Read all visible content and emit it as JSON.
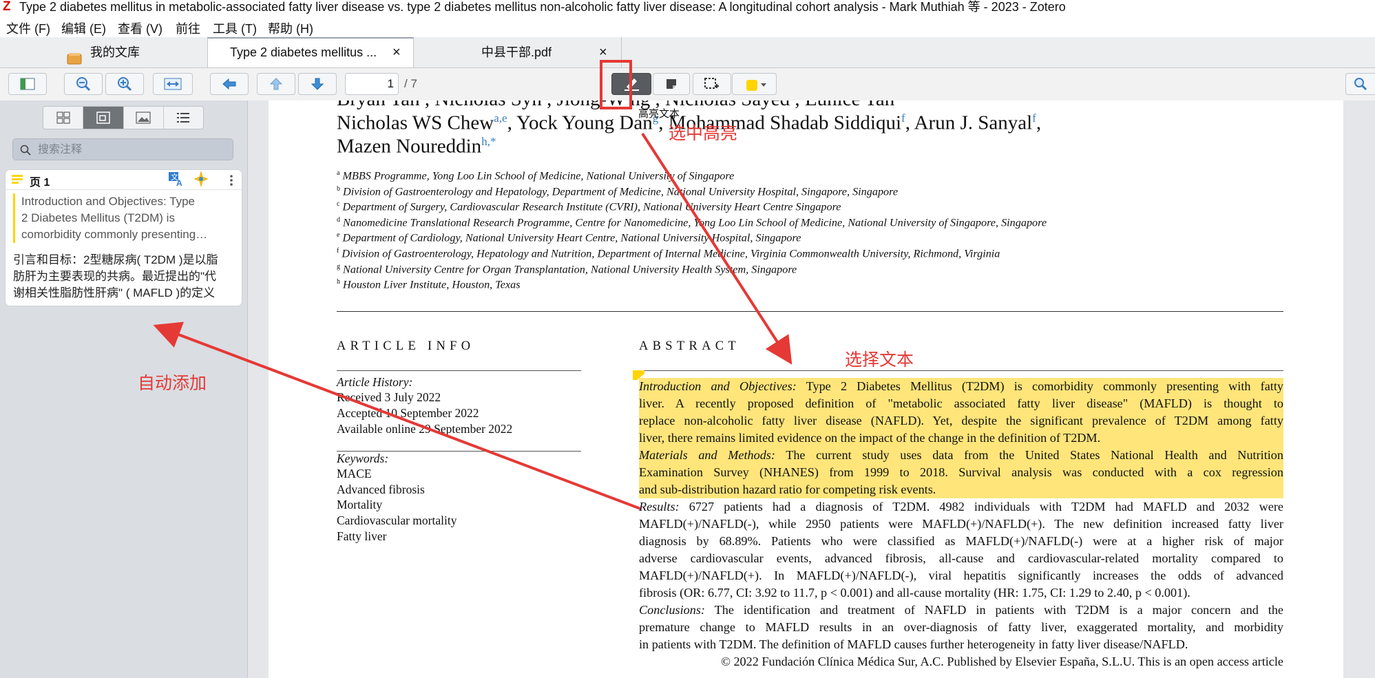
{
  "window": {
    "title": "Type 2 diabetes mellitus in metabolic-associated fatty liver disease vs. type 2 diabetes mellitus non-alcoholic fatty liver disease: A longitudinal cohort analysis - Mark Muthiah 等 - 2023 - Zotero"
  },
  "menu": [
    "文件 (F)",
    "编辑 (E)",
    "查看 (V)",
    "前往",
    "工具 (T)",
    "帮助 (H)"
  ],
  "tabs": [
    {
      "label": "我的文库",
      "icon": "library-icon"
    },
    {
      "label": "Type 2 diabetes mellitus ...",
      "close": "×"
    },
    {
      "label": "中县干部.pdf",
      "close": "×"
    }
  ],
  "toolbar": {
    "page_current": "1",
    "page_total": "/ 7",
    "highlight_tooltip": "高亮文本",
    "highlight_color": "#ffd400"
  },
  "sidebar": {
    "search_placeholder": "搜索注释",
    "annotation": {
      "page_label": "页 1",
      "quote_lines": [
        "Introduction and Objectives: Type",
        "2 Diabetes Mellitus (T2DM) is",
        "comorbidity commonly presenting…"
      ],
      "comment_lines": [
        "引言和目标：2型糖尿病( T2DM )是以脂",
        "肪肝为主要表现的共病。最近提出的\"代",
        "谢相关性脂肪性肝病\" ( MAFLD )的定义"
      ]
    }
  },
  "document": {
    "author_line1": "Bryan Tan , Nicholas Syn , Jiong-W  ng , Nicholas Sayed , Eunice Tan",
    "author_line2_parts": [
      "Nicholas WS Chew",
      "a,e",
      ", Yock Young Dan",
      "g",
      ", Mohammad Shadab Siddiqui",
      "f",
      ", Arun J. Sanyal",
      "f",
      ","
    ],
    "author_line3_parts": [
      "Mazen Noureddin",
      "h,*"
    ],
    "affiliations": [
      {
        "sup": "a",
        "text": "MBBS Programme, Yong Loo Lin School of Medicine, National University of Singapore"
      },
      {
        "sup": "b",
        "text": "Division of Gastroenterology and Hepatology, Department of Medicine, National University Hospital, Singapore, Singapore"
      },
      {
        "sup": "c",
        "text": "Department of Surgery, Cardiovascular Research Institute (CVRI), National University Heart Centre Singapore"
      },
      {
        "sup": "d",
        "text": "Nanomedicine Translational Research Programme, Centre for Nanomedicine, Yong Loo Lin School of Medicine, National University of Singapore, Singapore"
      },
      {
        "sup": "e",
        "text": "Department of Cardiology, National University Heart Centre, National University Hospital, Singapore"
      },
      {
        "sup": "f",
        "text": "Division of Gastroenterology, Hepatology and Nutrition, Department of Internal Medicine, Virginia Commonwealth University, Richmond, Virginia"
      },
      {
        "sup": "g",
        "text": "National University Centre for Organ Transplantation, National University Health System, Singapore"
      },
      {
        "sup": "h",
        "text": "Houston Liver Institute, Houston, Texas"
      }
    ],
    "article_info_heading": "ARTICLE INFO",
    "history_label": "Article History:",
    "history": [
      "Received 3 July 2022",
      "Accepted 10 September 2022",
      "Available online 29 September 2022"
    ],
    "keywords_label": "Keywords:",
    "keywords": [
      "MACE",
      "Advanced fibrosis",
      "Mortality",
      "Cardiovascular mortality",
      "Fatty liver"
    ],
    "abstract_heading": "ABSTRACT",
    "abstract_lines": [
      {
        "lead": "Introduction and Objectives:",
        "text": " Type 2 Diabetes Mellitus (T2DM) is comorbidity commonly presenting with fatty",
        "hl": true
      },
      {
        "lead": "",
        "text": "liver. A recently proposed definition of \"metabolic associated fatty liver disease\" (MAFLD) is thought to",
        "hl": true
      },
      {
        "lead": "",
        "text": "replace non-alcoholic fatty liver disease (NAFLD). Yet, despite the significant prevalence of T2DM among fatty",
        "hl": true
      },
      {
        "lead": "",
        "text": "liver, there remains limited evidence on the impact of the change in the definition of T2DM.",
        "hl": true,
        "last": true
      },
      {
        "lead": "Materials and Methods:",
        "text": " The current study uses data from the United States National Health and Nutrition",
        "hl": true
      },
      {
        "lead": "",
        "text": "Examination Survey (NHANES) from 1999 to 2018. Survival analysis was conducted with a cox regression",
        "hl": true
      },
      {
        "lead": "",
        "text": "and sub-distribution hazard ratio for competing risk events.",
        "hl": true,
        "last": true
      },
      {
        "lead": "Results:",
        "text": " 6727 patients had a diagnosis of T2DM. 4982 individuals with T2DM had MAFLD and 2032 were",
        "hl": false
      },
      {
        "lead": "",
        "text": "MAFLD(+)/NAFLD(-), while 2950 patients were MAFLD(+)/NAFLD(+). The new definition increased fatty liver",
        "hl": false
      },
      {
        "lead": "",
        "text": "diagnosis by 68.89%. Patients who were classified as MAFLD(+)/NAFLD(-) were at a higher risk of major",
        "hl": false
      },
      {
        "lead": "",
        "text": "adverse cardiovascular events, advanced fibrosis, all-cause and cardiovascular-related mortality compared to",
        "hl": false
      },
      {
        "lead": "",
        "text": "MAFLD(+)/NAFLD(+). In MAFLD(+)/NAFLD(-), viral hepatitis significantly increases the odds of advanced",
        "hl": false
      },
      {
        "lead": "",
        "text": "fibrosis (OR: 6.77, CI: 3.92 to 11.7, p < 0.001) and all-cause mortality (HR: 1.75, CI: 1.29 to 2.40, p < 0.001).",
        "hl": false,
        "last": true
      },
      {
        "lead": "Conclusions:",
        "text": " The identification and treatment of NAFLD in patients with T2DM is a major concern and the",
        "hl": false
      },
      {
        "lead": "",
        "text": "premature change to MAFLD results in an over-diagnosis of fatty liver, exaggerated mortality, and morbidity",
        "hl": false
      },
      {
        "lead": "",
        "text": "in patients with T2DM. The definition of MAFLD causes further heterogeneity in fatty liver disease/NAFLD.",
        "hl": false,
        "last": true
      },
      {
        "lead": "",
        "text": "© 2022 Fundación Clínica Médica Sur, A.C. Published by Elsevier España, S.L.U. This is an open access article",
        "hl": false,
        "right": true
      }
    ]
  },
  "callouts": {
    "select_highlight": "选中高亮",
    "select_text": "选择文本",
    "auto_add": "自动添加",
    "color": "#e53935"
  }
}
